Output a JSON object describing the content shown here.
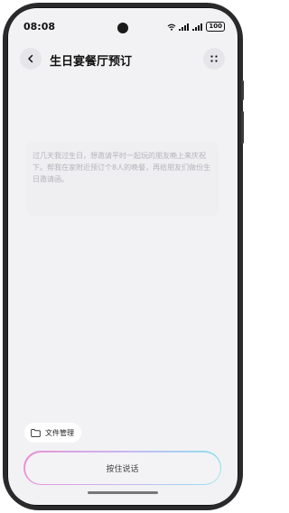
{
  "status_bar": {
    "time": "08:08",
    "battery": "100"
  },
  "header": {
    "title": "生日宴餐厅预订",
    "back_icon": "chevron-left-icon",
    "more_icon": "dots-grid-icon"
  },
  "prompt": {
    "text": "过几天我过生日，想邀请平时一起玩的朋友晚上来庆祝下。帮我在家附近预订个8人的晚餐，再给朋友们做份生日邀请函。"
  },
  "file_manager": {
    "label": "文件管理",
    "icon": "folder-icon"
  },
  "voice_input": {
    "label": "按住说话"
  },
  "colors": {
    "screen_bg": "#f2f2f4",
    "prompt_text": "#b4b4ba",
    "voice_gradient_start": "#e892d4",
    "voice_gradient_end": "#8fe0ee"
  }
}
